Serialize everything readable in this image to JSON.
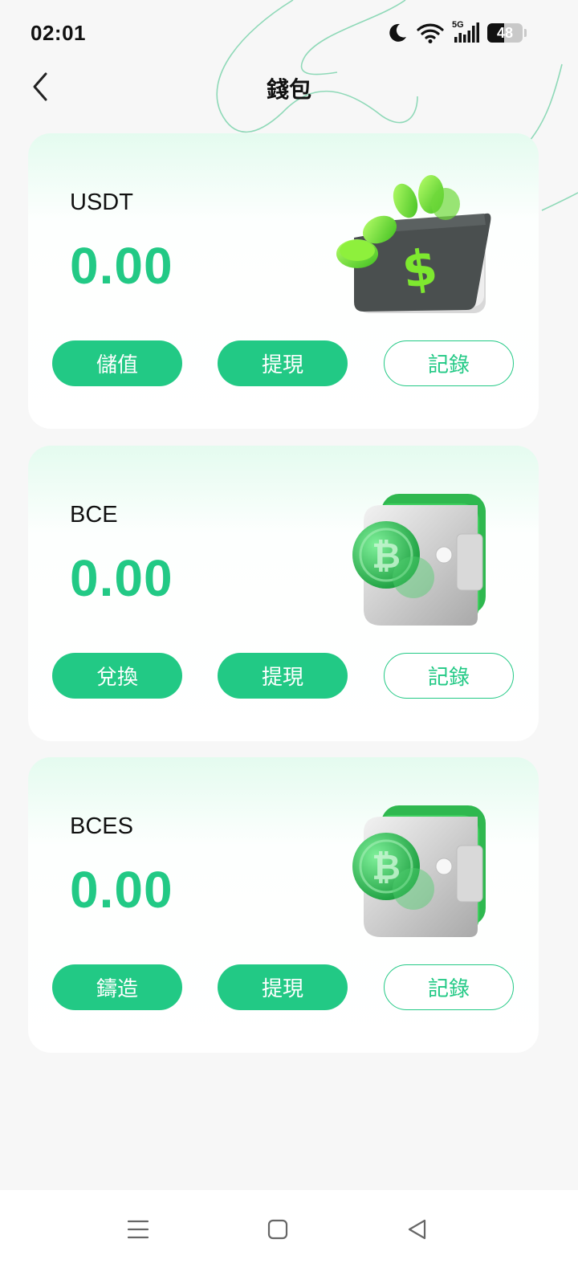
{
  "status_bar": {
    "time": "02:01",
    "network": "5G",
    "battery_level": "48",
    "battery_fraction": 0.48,
    "icons": [
      "moon-icon",
      "wifi-icon",
      "signal-icon",
      "battery-icon"
    ]
  },
  "header": {
    "title": "錢包",
    "back_icon": "chevron-left-icon"
  },
  "wallets": [
    {
      "name": "USDT",
      "balance": "0.00",
      "art": "wallet-dollar-coins-illustration",
      "buttons": [
        "儲值",
        "提現",
        "記錄"
      ]
    },
    {
      "name": "BCE",
      "balance": "0.00",
      "art": "wallet-bitcoin-coin-illustration",
      "buttons": [
        "兌換",
        "提現",
        "記錄"
      ]
    },
    {
      "name": "BCES",
      "balance": "0.00",
      "art": "wallet-bitcoin-coin-illustration",
      "buttons": [
        "鑄造",
        "提現",
        "記錄"
      ]
    }
  ],
  "nav": {
    "icons": [
      "menu-icon",
      "home-square-icon",
      "back-triangle-icon"
    ]
  },
  "colors": {
    "accent": "#22c985",
    "page_background": "#f7f7f7",
    "card_top_tint": "#e4fbef"
  }
}
